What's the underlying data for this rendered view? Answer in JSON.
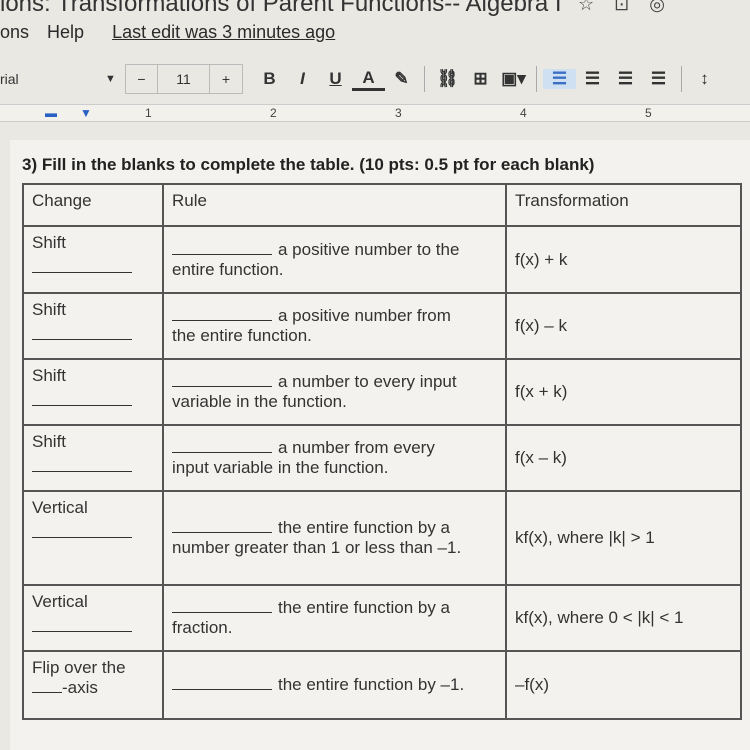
{
  "window": {
    "title": "ions: Transformations of Parent Functions-- Algebra I"
  },
  "menu": {
    "items": [
      "ons",
      "Help"
    ],
    "last_edit": "Last edit was 3 minutes ago"
  },
  "toolbar": {
    "font": "rial",
    "font_size": "11",
    "minus": "−",
    "plus": "+",
    "bold": "B",
    "italic": "I",
    "underline": "U",
    "text_color": "A"
  },
  "ruler": {
    "marks": [
      "1",
      "2",
      "3",
      "4",
      "5"
    ]
  },
  "document": {
    "question": "3) Fill in the blanks to complete the table. (10 pts: 0.5 pt for each blank)",
    "headers": [
      "Change",
      "Rule",
      "Transformation"
    ],
    "rows": [
      {
        "change": "Shift",
        "change_after": "",
        "rule_first": "a positive number to the",
        "rule_second": "entire function.",
        "transformation": "f(x) + k"
      },
      {
        "change": "Shift",
        "change_after": "",
        "rule_first": "a positive number from",
        "rule_second": "the entire function.",
        "transformation": "f(x) – k"
      },
      {
        "change": "Shift",
        "change_after": "",
        "rule_first": "a number to every input",
        "rule_second": "variable in the function.",
        "transformation": "f(x + k)"
      },
      {
        "change": "Shift",
        "change_after": "",
        "rule_first": "a number from every",
        "rule_second": "input variable in the function.",
        "transformation": "f(x – k)"
      },
      {
        "change": "Vertical",
        "change_after": "",
        "rule_first": "the entire function by a",
        "rule_second": "number greater than 1 or less than –1.",
        "transformation": "kf(x), where |k| > 1"
      },
      {
        "change": "Vertical",
        "change_after": "",
        "rule_first": "the entire function by a",
        "rule_second": "fraction.",
        "transformation": "kf(x), where 0 < |k| < 1"
      },
      {
        "change": "Flip over the",
        "change_after": "-axis",
        "rule_first": "the entire function by –1.",
        "rule_second": "",
        "transformation": "–f(x)"
      }
    ]
  }
}
